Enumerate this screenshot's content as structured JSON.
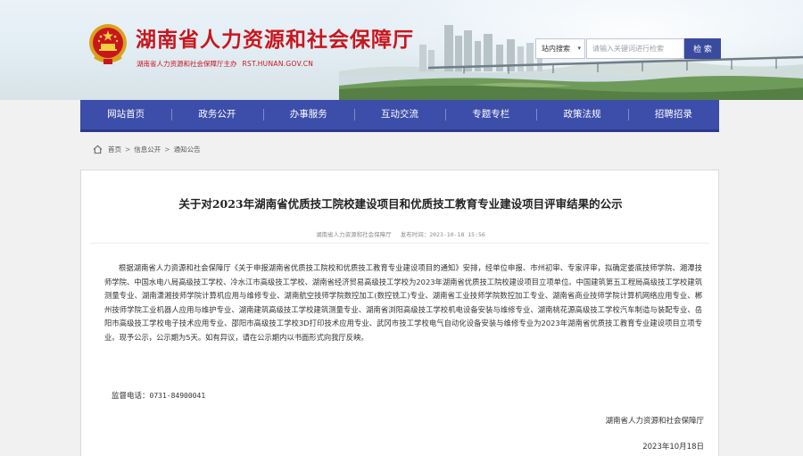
{
  "header": {
    "site_title": "湖南省人力资源和社会保障厅",
    "site_sub": "湖南省人力资源和社会保障厅主办",
    "site_url": "RST.HUNAN.GOV.CN",
    "search": {
      "scope_label": "站内搜索",
      "placeholder": "请输入关键词进行检索",
      "button_label": "检 索"
    }
  },
  "nav": {
    "items": [
      {
        "label": "网站首页"
      },
      {
        "label": "政务公开"
      },
      {
        "label": "办事服务"
      },
      {
        "label": "互动交流"
      },
      {
        "label": "专题专栏"
      },
      {
        "label": "政策法规"
      },
      {
        "label": "招聘招录"
      }
    ]
  },
  "breadcrumb": {
    "items": [
      "首页",
      "信息公开",
      "通知公告"
    ],
    "separator": ">"
  },
  "article": {
    "title": "关于对2023年湖南省优质技工院校建设项目和优质技工教育专业建设项目评审结果的公示",
    "source": "湖南省人力资源和社会保障厅",
    "publish_label": "发布时间：",
    "publish_time": "2023-10-18 15:56",
    "body": "根据湖南省人力资源和社会保障厅《关于申报湖南省优质技工院校和优质技工教育专业建设项目的通知》安排，经单位申报、市州初审、专家评审，拟确定娄底技师学院、湘潭技师学院、中国水电八局高级技工学校、冷水江市高级技工学校、湖南省经济贸易高级技工学校为2023年湖南省优质技工院校建设项目立项单位。中国建筑第五工程局高级技工学校建筑测量专业、湖南潇湘技师学院计算机应用与维修专业、湖南航空技师学院数控加工(数控铣工)专业、湖南省工业技师学院数控加工专业、湖南省商业技师学院计算机网络应用专业、郴州技师学院工业机器人应用与维护专业、湖南建筑高级技工学校建筑测量专业、湖南省浏阳高级技工学校机电设备安装与维修专业、湖南桃花源高级技工学校汽车制造与装配专业、岳阳市高级技工学校电子技术应用专业、邵阳市高级技工学校3D打印技术应用专业、武冈市技工学校电气自动化设备安装与维修专业为2023年湖南省优质技工教育专业建设项目立项专业。现予公示，公示期为5天。如有异议，请在公示期内以书面形式向我厅反映。",
    "phone_label": "监督电话：",
    "phone": "0731-84900041",
    "org": "湖南省人力资源和社会保障厅",
    "date": "2023年10月18日"
  },
  "colors": {
    "brand_red": "#c8161d",
    "nav_blue": "#3d4daa",
    "search_button": "#3a4a9f"
  }
}
